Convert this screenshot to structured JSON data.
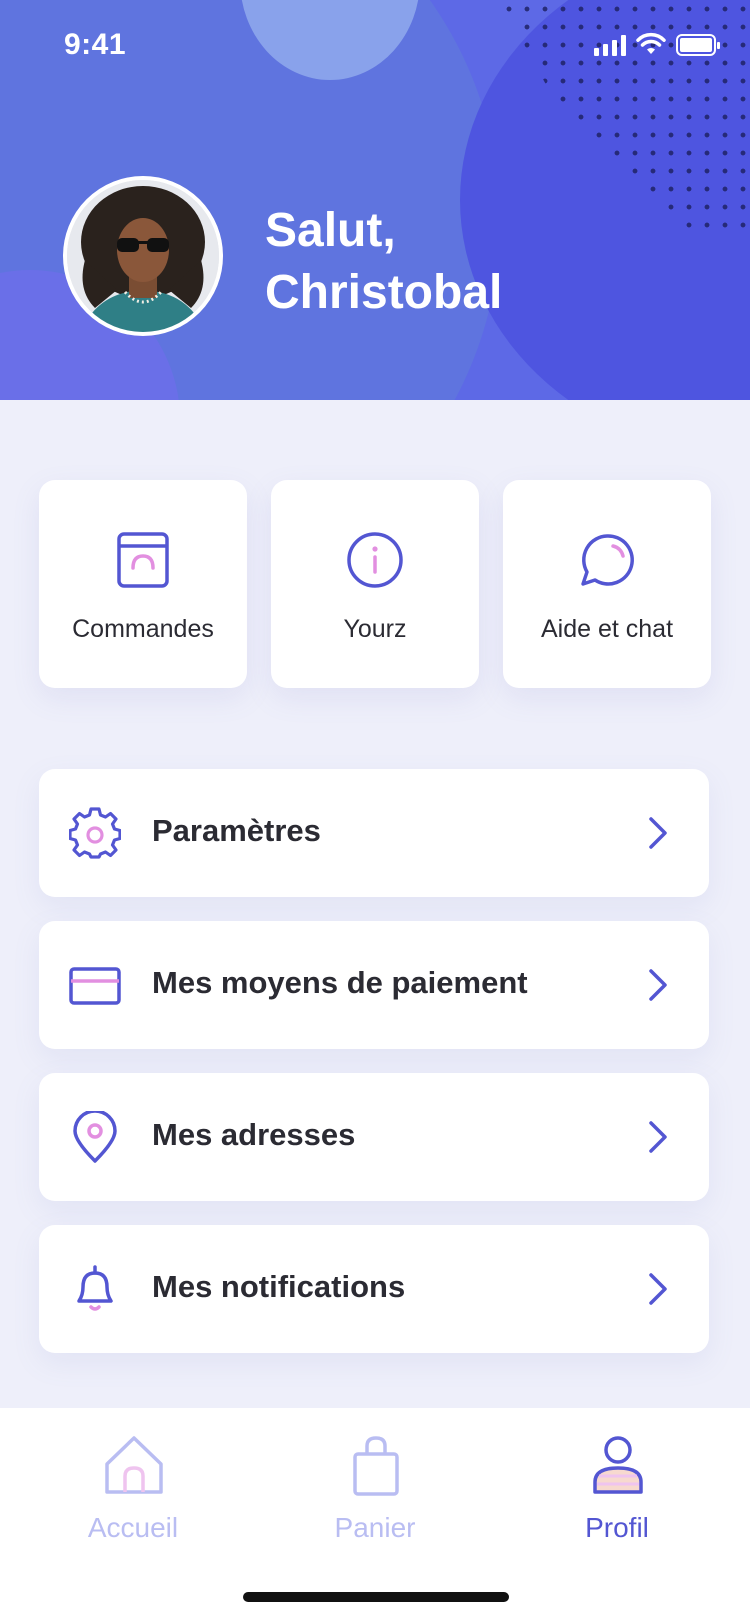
{
  "status": {
    "time": "9:41"
  },
  "profile": {
    "greeting_line1": "Salut,",
    "greeting_line2": "Christobal"
  },
  "quick_actions": [
    {
      "label": "Commandes",
      "icon": "order-box-icon"
    },
    {
      "label": "Yourz",
      "icon": "info-icon"
    },
    {
      "label": "Aide et chat",
      "icon": "chat-bubble-icon"
    }
  ],
  "menu": [
    {
      "label": "Paramètres",
      "icon": "gear-icon"
    },
    {
      "label": "Mes moyens de paiement",
      "icon": "credit-card-icon"
    },
    {
      "label": "Mes adresses",
      "icon": "location-pin-icon"
    },
    {
      "label": "Mes notifications",
      "icon": "bell-icon"
    }
  ],
  "tabbar": [
    {
      "label": "Accueil",
      "icon": "home-icon",
      "active": false
    },
    {
      "label": "Panier",
      "icon": "shopping-bag-icon",
      "active": false
    },
    {
      "label": "Profil",
      "icon": "user-icon",
      "active": true
    }
  ],
  "colors": {
    "accent": "#5356d2",
    "accent_light": "#b9bdf2",
    "pink": "#e28fe0",
    "header_bg": "#5d69e6",
    "page_bg": "#eeeffa"
  }
}
